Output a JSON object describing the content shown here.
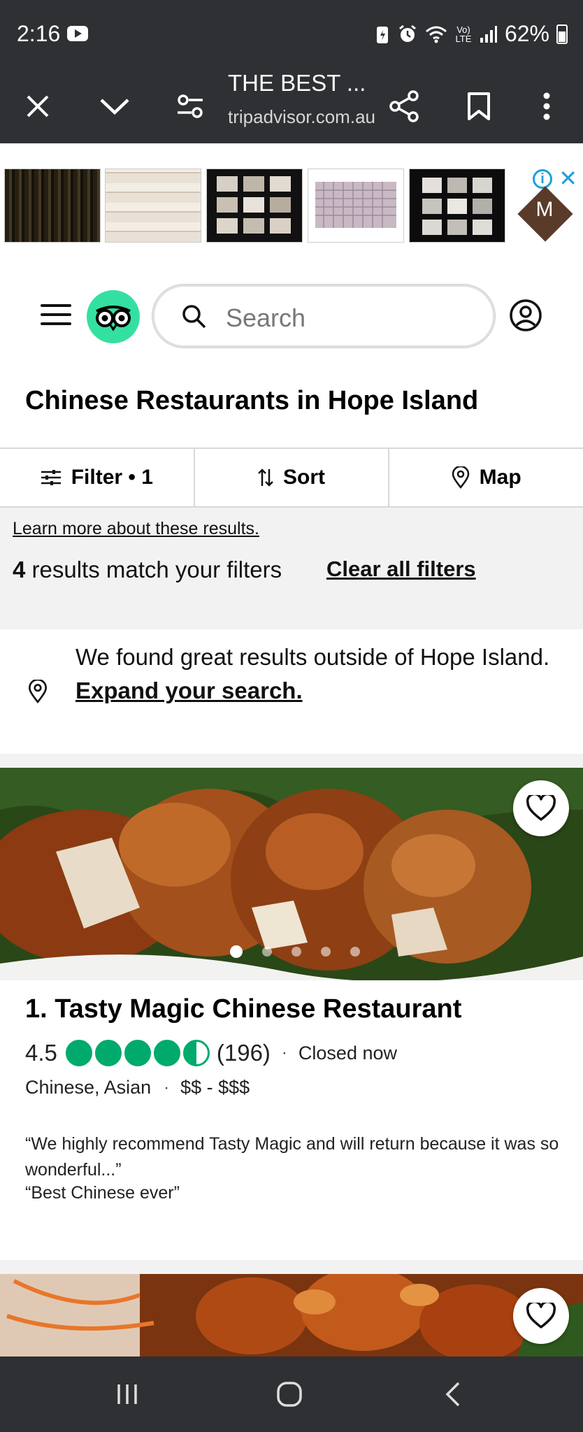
{
  "status_bar": {
    "time": "2:16",
    "battery": "62%",
    "network_label": "Vo) LTE"
  },
  "browser": {
    "tab_title": "THE BEST ...",
    "url": "tripadvisor.com.au"
  },
  "ad": {
    "logo_letter": "M"
  },
  "header": {
    "search_placeholder": "Search"
  },
  "page_title": "Chinese Restaurants in Hope Island",
  "filter_bar": {
    "filter_label": "Filter • 1",
    "sort_label": "Sort",
    "map_label": "Map"
  },
  "info": {
    "learn_more": "Learn more about these results.",
    "results_count": "4",
    "results_text": "results match your filters",
    "clear_filters": "Clear all filters"
  },
  "outside_note": {
    "text": "We found great results outside of Hope Island.",
    "link": "Expand your search."
  },
  "restaurant": {
    "title": "1. Tasty Magic Chinese Restaurant",
    "rating": "4.5",
    "rating_value": 4.5,
    "review_count": "(196)",
    "separator": "·",
    "status": "Closed now",
    "cuisine": "Chinese, Asian",
    "price": "$$ - $$$",
    "quote1": "“We highly recommend Tasty Magic and will return because it was so wonderful...”",
    "quote2": "“Best Chinese ever”",
    "photo_index": 1,
    "photo_count": 5
  },
  "colors": {
    "brand_green": "#34e0a1",
    "bubble_green": "#00aa6c",
    "system_bar": "#2f3034"
  }
}
